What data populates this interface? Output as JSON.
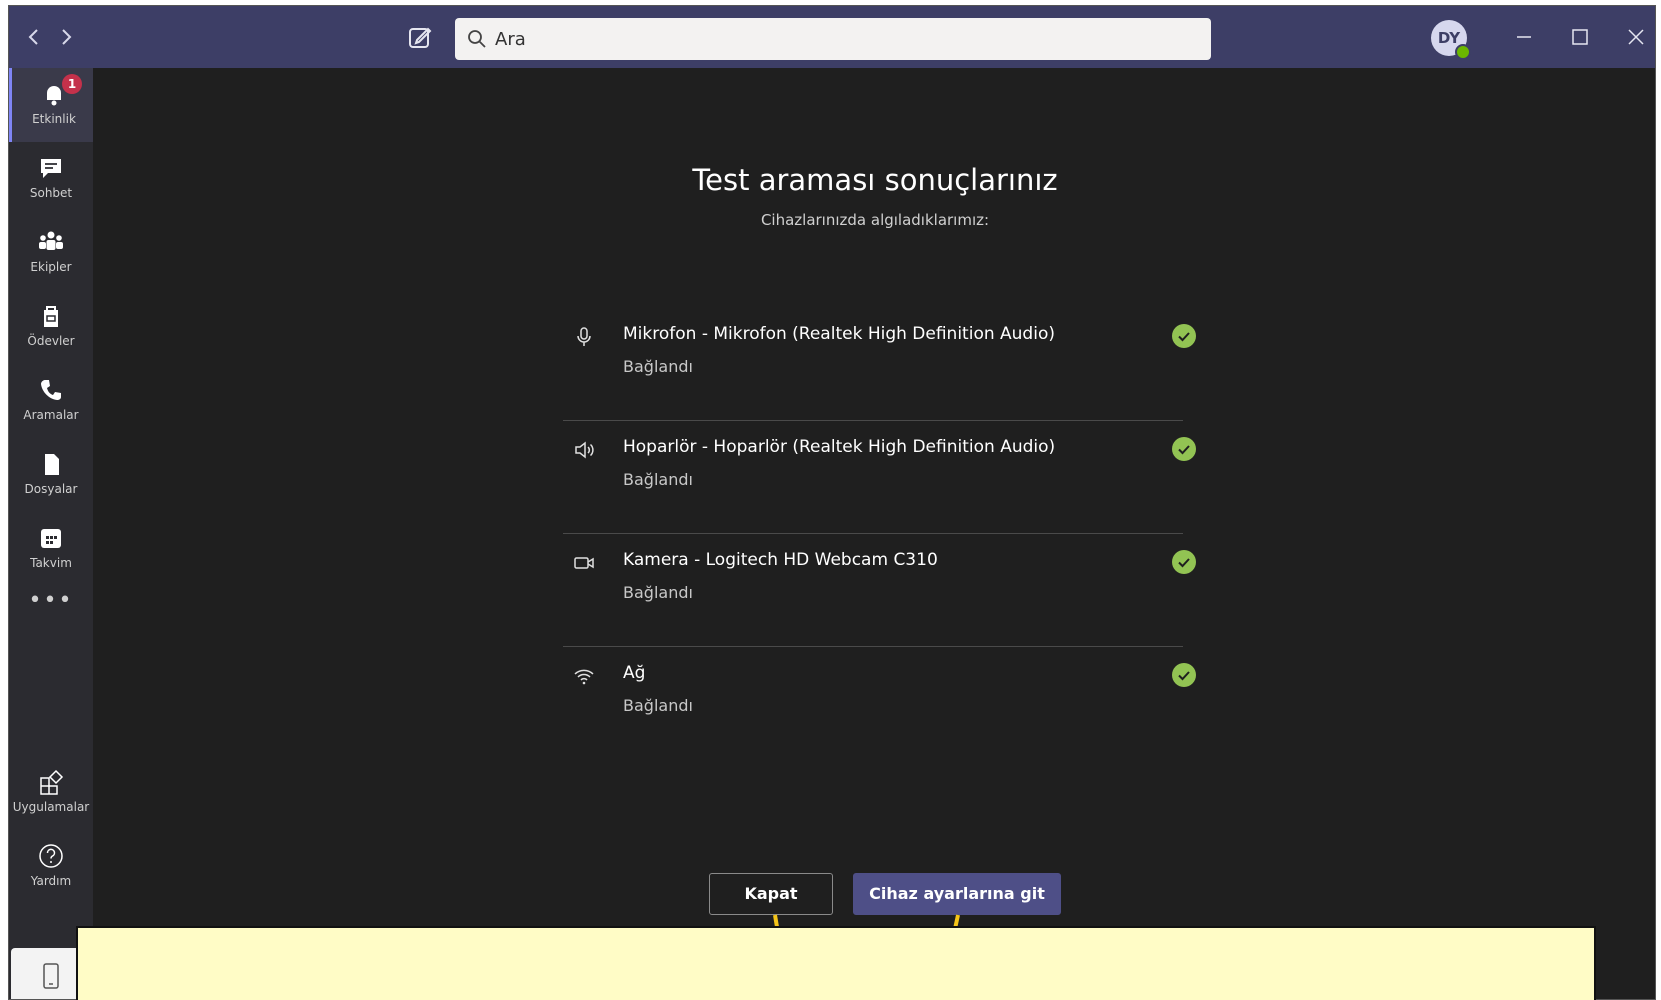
{
  "titlebar": {
    "back_icon": "chevron-left-icon",
    "forward_icon": "chevron-right-icon",
    "search_placeholder": "Ara",
    "avatar_initials": "DY",
    "status_color": "#6bb700"
  },
  "rail": {
    "items": [
      {
        "label": "Etkinlik",
        "icon": "bell-icon",
        "badge": "1"
      },
      {
        "label": "Sohbet",
        "icon": "chat-icon"
      },
      {
        "label": "Ekipler",
        "icon": "teams-icon"
      },
      {
        "label": "Ödevler",
        "icon": "assignments-icon"
      },
      {
        "label": "Aramalar",
        "icon": "phone-icon"
      },
      {
        "label": "Dosyalar",
        "icon": "file-icon"
      },
      {
        "label": "Takvim",
        "icon": "calendar-icon"
      }
    ],
    "more_label": "•••",
    "apps_label": "Uygulamalar",
    "help_label": "Yardım"
  },
  "main": {
    "title": "Test araması sonuçlarınız",
    "subtitle": "Cihazlarınızda algıladıklarımız:",
    "devices": [
      {
        "name": "Mikrofon - Mikrofon (Realtek High Definition Audio)",
        "status": "Bağlandı",
        "icon": "microphone-icon"
      },
      {
        "name": "Hoparlör - Hoparlör (Realtek High Definition Audio)",
        "status": "Bağlandı",
        "icon": "speaker-icon"
      },
      {
        "name": "Kamera - Logitech HD Webcam C310",
        "status": "Bağlandı",
        "icon": "camera-icon"
      },
      {
        "name": "Ağ",
        "status": "Bağlandı",
        "icon": "wifi-icon"
      }
    ],
    "close_label": "Kapat",
    "settings_label": "Cihaz ayarlarına git"
  },
  "colors": {
    "titlebar": "#3d3e66",
    "accent": "#4e4f87",
    "success": "#92c353",
    "callout": "#fffcc6",
    "pointer": "#f5c518"
  }
}
